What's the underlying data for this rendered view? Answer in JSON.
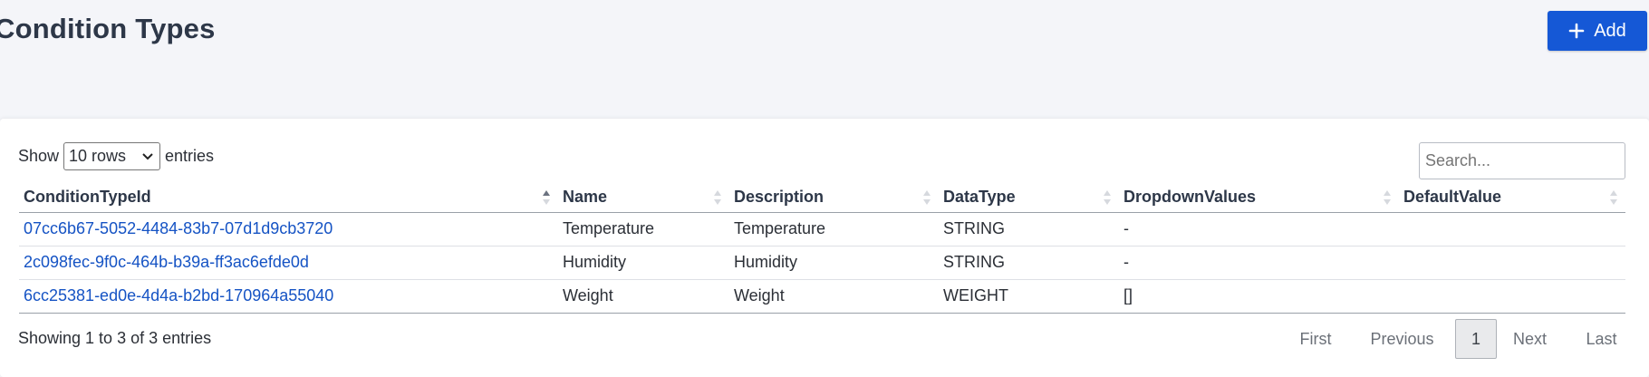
{
  "header": {
    "title": "Condition Types",
    "add_label": "Add"
  },
  "controls": {
    "show_label": "Show",
    "rows_option": "10 rows",
    "entries_label": "entries",
    "search_placeholder": "Search..."
  },
  "table": {
    "columns": [
      "ConditionTypeId",
      "Name",
      "Description",
      "DataType",
      "DropdownValues",
      "DefaultValue"
    ],
    "rows": [
      [
        "07cc6b67-5052-4484-83b7-07d1d9cb3720",
        "Temperature",
        "Temperature",
        "STRING",
        "-",
        ""
      ],
      [
        "2c098fec-9f0c-464b-b39a-ff3ac6efde0d",
        "Humidity",
        "Humidity",
        "STRING",
        "-",
        ""
      ],
      [
        "6cc25381-ed0e-4d4a-b2bd-170964a55040",
        "Weight",
        "Weight",
        "WEIGHT",
        "[]",
        ""
      ]
    ]
  },
  "footer": {
    "info": "Showing 1 to 3 of 3 entries",
    "pagination": {
      "first": "First",
      "previous": "Previous",
      "current": "1",
      "next": "Next",
      "last": "Last"
    }
  },
  "colors": {
    "accent": "#1558d6",
    "link": "#1553c4",
    "background": "#f4f5f9"
  }
}
